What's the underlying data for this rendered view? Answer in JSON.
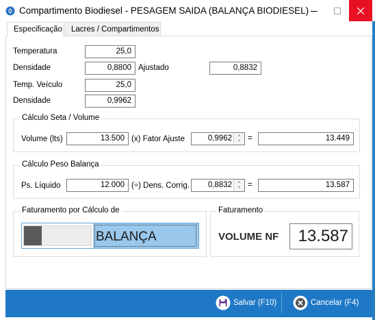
{
  "window": {
    "title": "Compartimento Biodiesel - PESAGEM SAIDA (BALANÇA BIODIESEL)",
    "minimize_icon": "minimize-icon",
    "maximize_icon": "maximize-icon",
    "close_icon": "close-icon"
  },
  "tabs": [
    {
      "label": "Especificação",
      "active": true
    },
    {
      "label": "Lacres / Compartimentos",
      "active": false
    }
  ],
  "spec": {
    "temperatura_label": "Temperatura",
    "temperatura_value": "25,0",
    "densidade_label": "Densidade",
    "densidade_value": "0,8800",
    "ajustado_label": "Ajustado",
    "ajustado_value": "0,8832",
    "temp_veiculo_label": "Temp. Veículo",
    "temp_veiculo_value": "25,0",
    "densidade2_label": "Densidade",
    "densidade2_value": "0,9962"
  },
  "calc_volume": {
    "title": "Cálculo Seta / Volume",
    "volume_label": "Volume (lts)",
    "volume_value": "13.500",
    "fator_label": "(x) Fator Ajuste",
    "fator_value": "0,9962",
    "equals": "=",
    "result_value": "13.449"
  },
  "calc_peso": {
    "title": "Cálculo Peso Balança",
    "liquido_label": "Ps. Líquido",
    "liquido_value": "12.000",
    "dens_label": "(÷) Dens. Corrig.",
    "dens_value": "0,8832",
    "equals": "=",
    "result_value": "13.587"
  },
  "faturamento_calc": {
    "title": "Faturamento por Cálculo de",
    "toggle_label": "BALANÇA",
    "toggle_state": "BALANÇA"
  },
  "faturamento": {
    "title": "Faturamento",
    "label": "VOLUME NF",
    "value": "13.587"
  },
  "footer": {
    "save_label": "Salvar (F10)",
    "save_icon": "save-icon",
    "cancel_label": "Cancelar (F4)",
    "cancel_icon": "cancel-icon"
  },
  "colors": {
    "footer_bg": "#1e78c6",
    "toggle_selected": "#9ac8ec",
    "close_red": "#e81123"
  }
}
